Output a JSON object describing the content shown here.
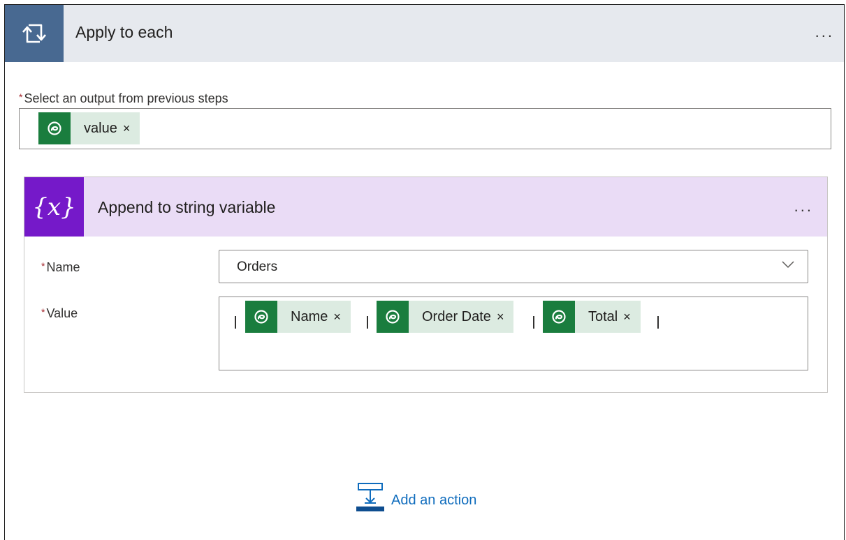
{
  "apply_each": {
    "title": "Apply to each",
    "more": "...",
    "output_label": "Select an output from previous steps",
    "required_mark": "*",
    "token": {
      "label": "value",
      "remove": "×",
      "icon": "dataverse-icon"
    }
  },
  "append_variable": {
    "title": "Append to string variable",
    "icon_text": "{x}",
    "more": "...",
    "name_field": {
      "label": "Name",
      "required_mark": "*",
      "value": "Orders"
    },
    "value_field": {
      "label": "Value",
      "required_mark": "*",
      "tokens": [
        {
          "label": "Name",
          "remove": "×",
          "icon": "dataverse-icon"
        },
        {
          "label": "Order Date",
          "remove": "×",
          "icon": "dataverse-icon"
        },
        {
          "label": "Total",
          "remove": "×",
          "icon": "dataverse-icon"
        }
      ]
    }
  },
  "add_action": {
    "label": "Add an action"
  },
  "colors": {
    "loop_accent": "#486991",
    "variable_accent": "#7519c9",
    "dataverse_green": "#1a7d3e",
    "link_blue": "#0f6cbd"
  }
}
